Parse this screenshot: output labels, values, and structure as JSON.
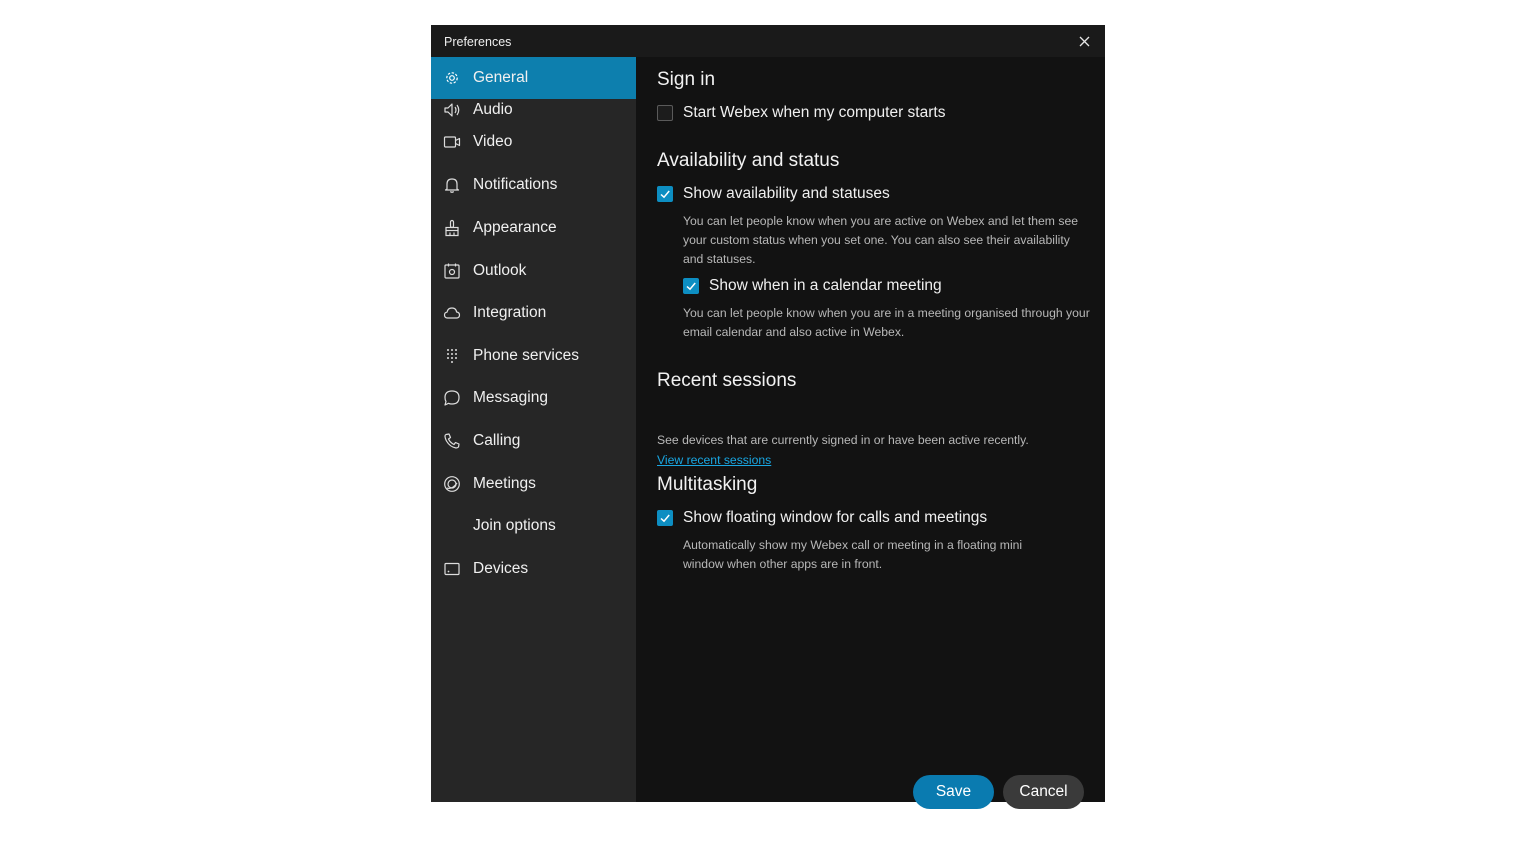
{
  "window": {
    "title": "Preferences",
    "close_icon": "close-icon"
  },
  "sidebar": {
    "items": [
      {
        "label": "General",
        "icon": "gear-icon",
        "active": true
      },
      {
        "label": "Audio",
        "icon": "speaker-icon"
      },
      {
        "label": "Video",
        "icon": "video-camera-icon"
      },
      {
        "label": "Notifications",
        "icon": "bell-icon"
      },
      {
        "label": "Appearance",
        "icon": "paintbrush-icon"
      },
      {
        "label": "Outlook",
        "icon": "calendar-icon"
      },
      {
        "label": "Integration",
        "icon": "cloud-icon"
      },
      {
        "label": "Phone services",
        "icon": "dialpad-icon"
      },
      {
        "label": "Messaging",
        "icon": "chat-bubble-icon"
      },
      {
        "label": "Calling",
        "icon": "phone-handset-icon"
      },
      {
        "label": "Meetings",
        "icon": "meetings-icon"
      },
      {
        "label": "Join options",
        "icon": ""
      },
      {
        "label": "Devices",
        "icon": "device-icon"
      }
    ]
  },
  "main": {
    "sign_in": {
      "heading": "Sign in",
      "start_webex": {
        "label": "Start Webex when my computer starts",
        "checked": false
      }
    },
    "availability": {
      "heading": "Availability and status",
      "show_availability": {
        "label": "Show availability and statuses",
        "checked": true,
        "description": "You can let people know when you are active on Webex and let them see your custom status when you set one. You can also see their availability and statuses."
      },
      "show_calendar": {
        "label": "Show when in a calendar meeting",
        "checked": true,
        "description": "You can let people know when you are in a meeting organised through your email calendar and also active in Webex."
      }
    },
    "recent_sessions": {
      "heading": "Recent sessions",
      "description": "See devices that are currently signed in or have been active recently.",
      "link": "View recent sessions"
    },
    "multitasking": {
      "heading": "Multitasking",
      "floating_window": {
        "label": "Show floating window for calls and meetings",
        "checked": true,
        "description": "Automatically show my Webex call or meeting in a floating mini window when other apps are in front."
      }
    }
  },
  "footer": {
    "save_label": "Save",
    "cancel_label": "Cancel"
  },
  "colors": {
    "accent": "#0d7fae",
    "checkbox": "#0d8ec2",
    "link": "#19a7e3",
    "sidebar_bg": "#262626",
    "content_bg": "#121212"
  }
}
